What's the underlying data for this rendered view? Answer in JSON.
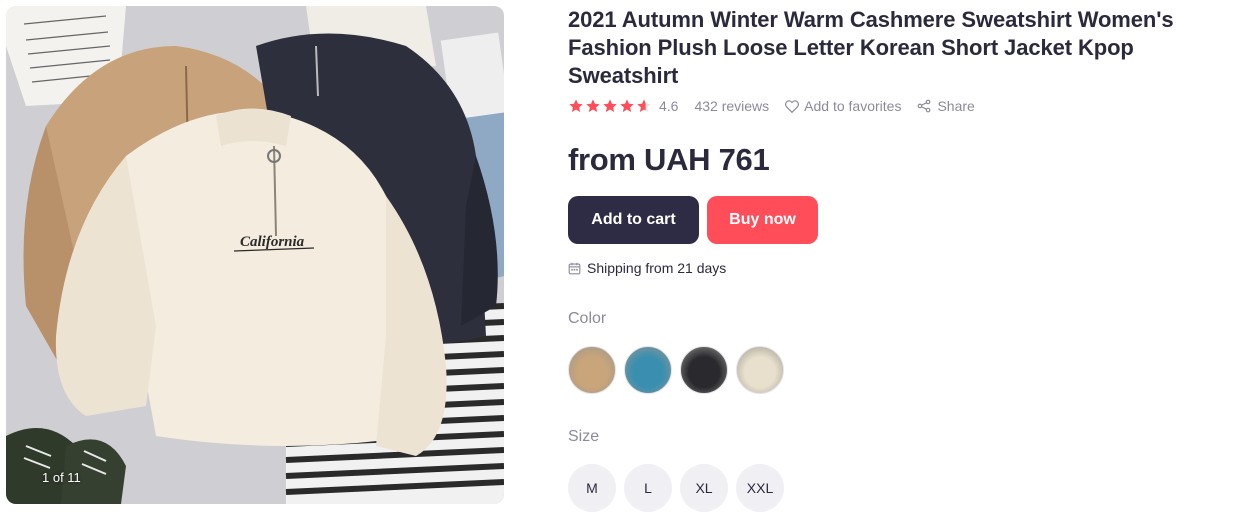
{
  "gallery": {
    "counter": "1 of 11",
    "image_alt": "sweatshirts-photo"
  },
  "product": {
    "title": "2021 Autumn Winter Warm Cashmere Sweatshirt Women's Fashion Plush Loose Letter Korean Short Jacket Kpop Sweatshirt",
    "rating_value": 4.6,
    "rating_text": "4.6",
    "reviews": "432 reviews",
    "favorites": "Add to favorites",
    "share": "Share",
    "price": "from UAH 761"
  },
  "actions": {
    "add_to_cart": "Add to cart",
    "buy_now": "Buy now"
  },
  "shipping": {
    "icon": "calendar-icon",
    "text": "Shipping from 21 days"
  },
  "color": {
    "label": "Color",
    "options": [
      {
        "name": "khaki",
        "hex": "#c8a57a"
      },
      {
        "name": "blue",
        "hex": "#3a8fb0"
      },
      {
        "name": "black",
        "hex": "#2a2a2e"
      },
      {
        "name": "beige",
        "hex": "#e8e0cc"
      }
    ]
  },
  "size": {
    "label": "Size",
    "options": [
      "M",
      "L",
      "XL",
      "XXL"
    ]
  },
  "colors": {
    "primary_dark": "#2e2b45",
    "accent_red": "#ff4d5a",
    "star": "#ff4d5a",
    "muted": "#8c8a99"
  }
}
